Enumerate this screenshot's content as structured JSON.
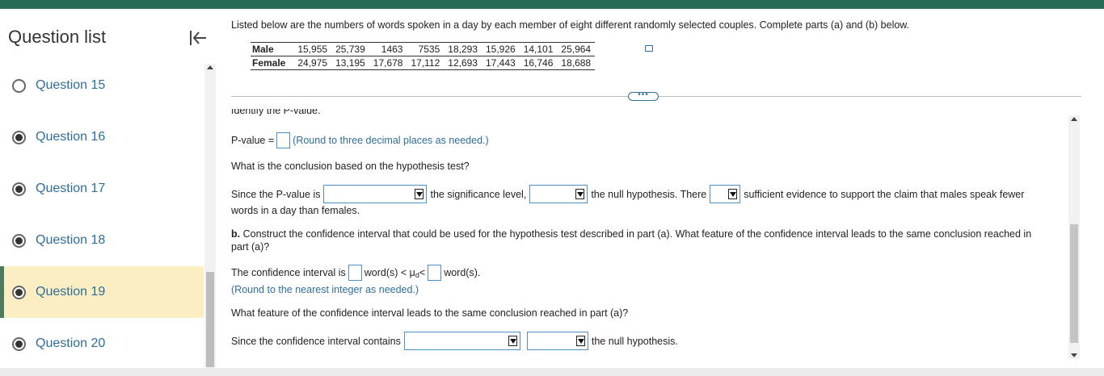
{
  "sidebar": {
    "title": "Question list",
    "collapse_icon": "collapse-left-icon",
    "items": [
      {
        "label": "Question 15",
        "status": "unanswered"
      },
      {
        "label": "Question 16",
        "status": "answered"
      },
      {
        "label": "Question 17",
        "status": "answered"
      },
      {
        "label": "Question 18",
        "status": "answered"
      },
      {
        "label": "Question 19",
        "status": "current"
      },
      {
        "label": "Question 20",
        "status": "answered"
      }
    ]
  },
  "problem": {
    "intro": "Listed below are the numbers of words spoken in a day by each member of eight different randomly selected couples. Complete parts (a) and (b) below.",
    "table": {
      "rows": [
        {
          "label": "Male",
          "values": [
            "15,955",
            "25,739",
            "1463",
            "7535",
            "18,293",
            "15,926",
            "14,101",
            "25,964"
          ]
        },
        {
          "label": "Female",
          "values": [
            "24,975",
            "13,195",
            "17,678",
            "17,112",
            "12,693",
            "17,443",
            "16,746",
            "18,688"
          ]
        }
      ]
    },
    "more_label": "•••",
    "cutoff_text": "Identify the P-value.",
    "pvalue_label": "P-value =",
    "pvalue_hint": "(Round to three decimal places as needed.)",
    "conclusion_question": "What is the conclusion based on the hypothesis test?",
    "since_pvalue": "Since the P-value is",
    "the_significance_level": "the significance level,",
    "the_null_there": "the null hypothesis. There",
    "sufficient_evidence": "sufficient evidence to support the claim that males speak fewer",
    "words_in_day": "words in a day than females.",
    "part_b_bold": "b.",
    "part_b_text": "Construct the confidence interval that could be used for the hypothesis test described in part (a). What feature of the confidence interval leads to the same conclusion reached in",
    "part_b_text2": "part (a)?",
    "ci_prefix": "The confidence interval is",
    "ci_mid1": "word(s) < μ",
    "ci_sub": "d",
    "ci_mid2": " <",
    "ci_suffix": "word(s).",
    "ci_hint": "(Round to the nearest integer as needed.)",
    "feature_question": "What feature of the confidence interval leads to the same conclusion reached in part (a)?",
    "since_ci": "Since the confidence interval contains",
    "the_null": "the null hypothesis."
  },
  "colors": {
    "topbar": "#2a6a58",
    "active_bg": "#faeec2",
    "link_blue": "#2f6e99"
  }
}
